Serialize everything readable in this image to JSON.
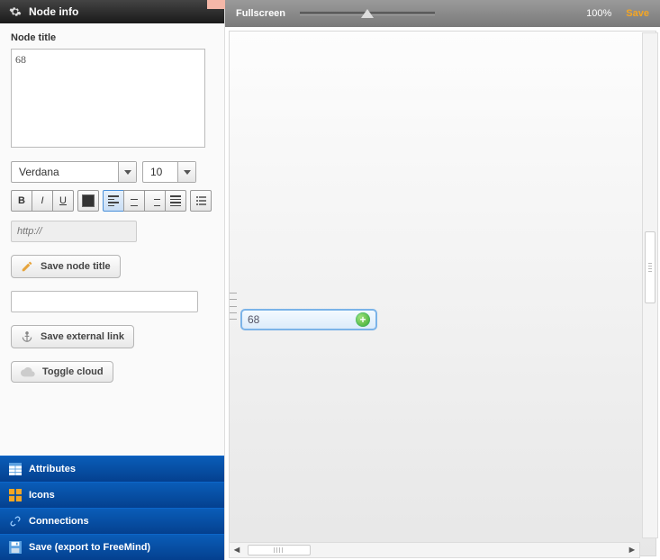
{
  "sidebar": {
    "header": "Node info",
    "node_title_label": "Node title",
    "node_title_value": "68",
    "font_family": "Verdana",
    "font_size": "10",
    "url_placeholder": "http://",
    "save_node_title_label": "Save node title",
    "external_link_value": "",
    "save_external_link_label": "Save external link",
    "toggle_cloud_label": "Toggle cloud",
    "accordion": {
      "attributes": "Attributes",
      "icons": "Icons",
      "connections": "Connections",
      "save_export": "Save (export to FreeMind)"
    }
  },
  "canvas": {
    "fullscreen_label": "Fullscreen",
    "zoom_percent": "100%",
    "save_label": "Save",
    "node_text": "68"
  },
  "icons": {
    "gear": "gear-icon",
    "pencil": "pencil-icon",
    "anchor": "anchor-icon",
    "cloud": "cloud-icon",
    "table": "table-icon",
    "grid": "grid-icon",
    "link": "link-icon",
    "disk": "disk-icon",
    "plus": "plus-icon"
  }
}
